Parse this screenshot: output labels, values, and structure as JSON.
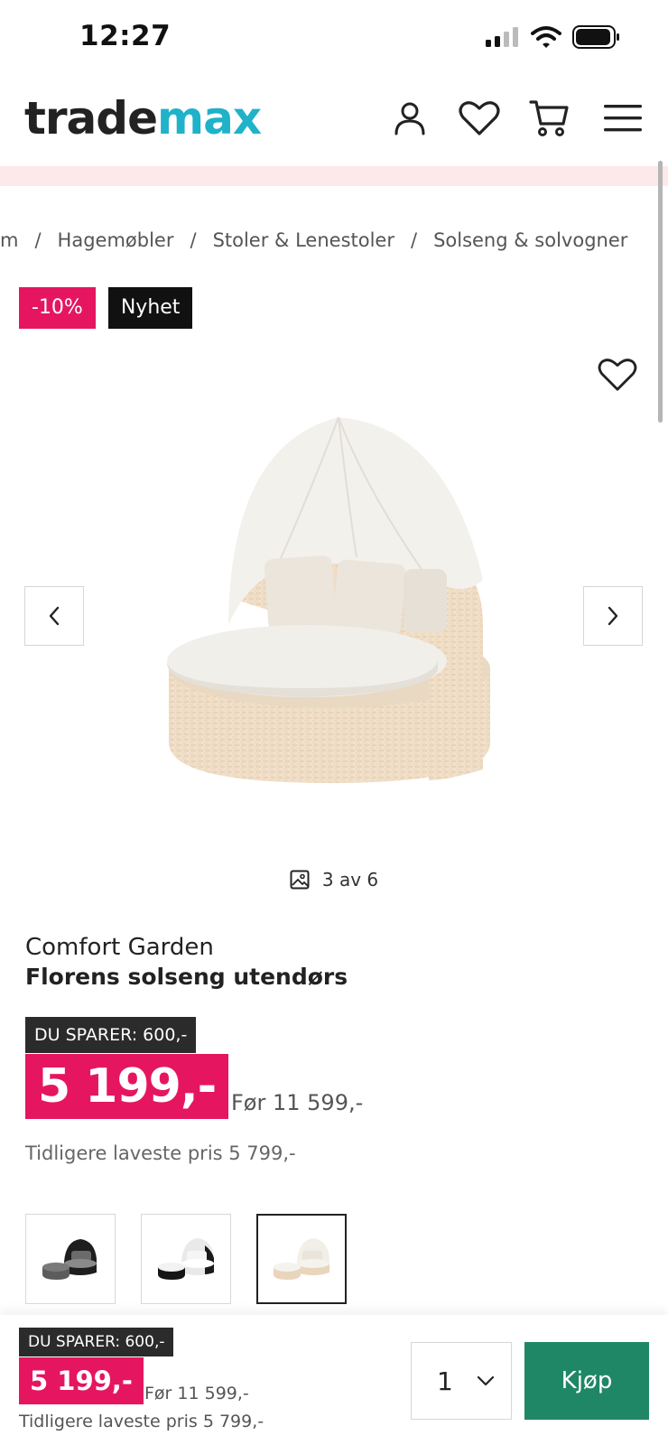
{
  "status_bar": {
    "time": "12:27"
  },
  "header": {
    "logo_part1": "trade",
    "logo_part2": "max",
    "icons": [
      "user-icon",
      "heart-icon",
      "cart-icon",
      "menu-icon"
    ],
    "colors": {
      "logo_accent": "#1fb2c9",
      "promo_strip": "#fde8ea"
    }
  },
  "breadcrumb": [
    "m",
    "Hagemøbler",
    "Stoler & Lenestoler",
    "Solseng & solvogner"
  ],
  "badges": {
    "discount": "-10%",
    "new": "Nyhet"
  },
  "gallery": {
    "counter": "3 av 6",
    "icons": [
      "chevron-left-icon",
      "chevron-right-icon",
      "image-icon",
      "heart-icon"
    ]
  },
  "product": {
    "brand": "Comfort Garden",
    "name": "Florens solseng utendørs",
    "save_label": "DU SPARER: 600,-",
    "price": "5 199,-",
    "before_price": "Før 11 599,-",
    "lowest_price": "Tidligere laveste pris 5 799,-"
  },
  "variants": [
    {
      "name": "black-grey",
      "selected": false
    },
    {
      "name": "black-white",
      "selected": false
    },
    {
      "name": "beige",
      "selected": true
    }
  ],
  "buy_bar": {
    "save_label": "DU SPARER: 600,-",
    "price": "5 199,-",
    "before_price": "Før 11 599,-",
    "lowest_price": "Tidligere laveste pris 5 799,-",
    "quantity": "1",
    "buy_label": "Kjøp"
  },
  "colors": {
    "discount": "#e5165f",
    "buy_button": "#1f8765",
    "dark_tag": "#2b2b2b"
  }
}
